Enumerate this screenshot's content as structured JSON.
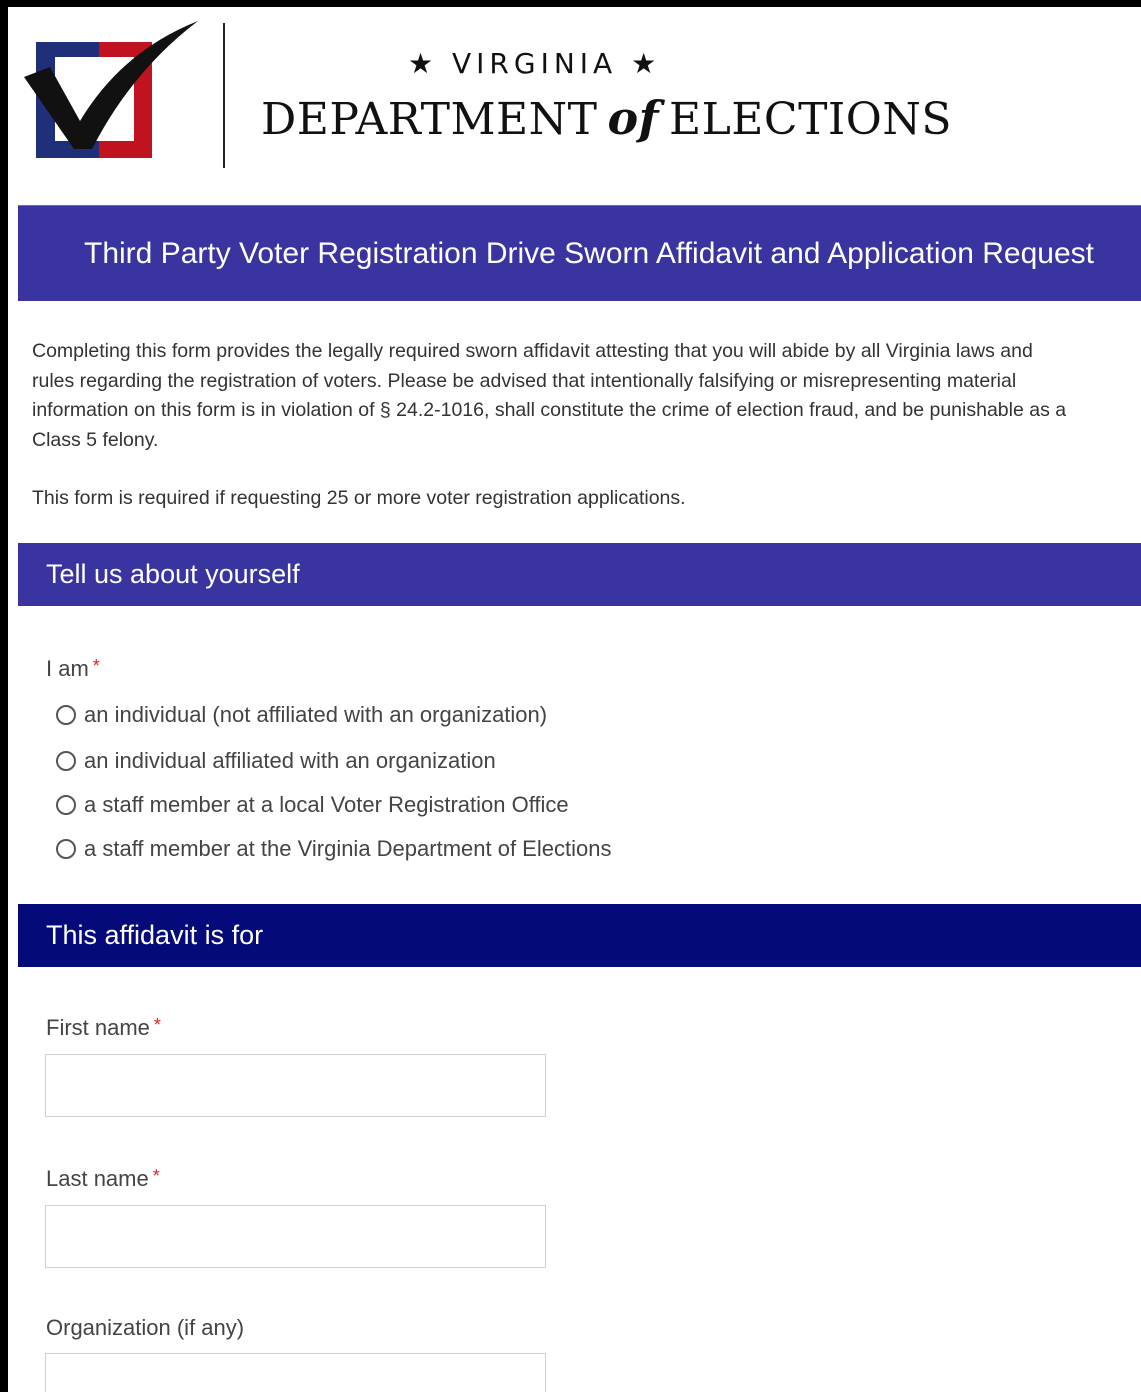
{
  "header": {
    "state": "★ VIRGINIA ★",
    "dept_pre": "DEPARTMENT",
    "dept_of": "of",
    "dept_post": "ELECTIONS"
  },
  "title": "Third Party Voter Registration Drive Sworn Affidavit and Application Request",
  "intro": {
    "lines": [
      "Completing this form provides the legally required sworn affidavit attesting that you will abide by all Virginia laws and",
      "rules regarding the registration of voters. Please be advised that intentionally falsifying or misrepresenting material",
      "information on this form is in violation of § 24.2-1016, shall constitute the crime of election fraud, and be punishable as a",
      "Class 5 felony."
    ],
    "requirement": "This form is required if requesting 25 or more voter registration applications."
  },
  "section_about": {
    "heading": "Tell us about yourself",
    "i_am_label": "I am",
    "required_mark": "*",
    "options": [
      "an individual (not affiliated with an organization)",
      "an individual affiliated with an organization",
      "a staff member at a local Voter Registration Office",
      "a staff member at the Virginia Department of Elections"
    ]
  },
  "section_affidavit": {
    "heading": "This affidavit is for",
    "first_name_label": "First name",
    "first_name_value": "",
    "last_name_label": "Last name",
    "last_name_value": "",
    "organization_label": "Organization (if any)",
    "organization_value": "",
    "required_mark": "*"
  },
  "colors": {
    "banner": "#3a34a0",
    "banner_dark": "#050a7a",
    "logo_blue": "#1f2f7a",
    "logo_red": "#c0121f",
    "required": "#dd2222"
  },
  "icons": {
    "logo": "checkmark-box-logo-icon",
    "radio": "radio-unchecked-icon"
  }
}
